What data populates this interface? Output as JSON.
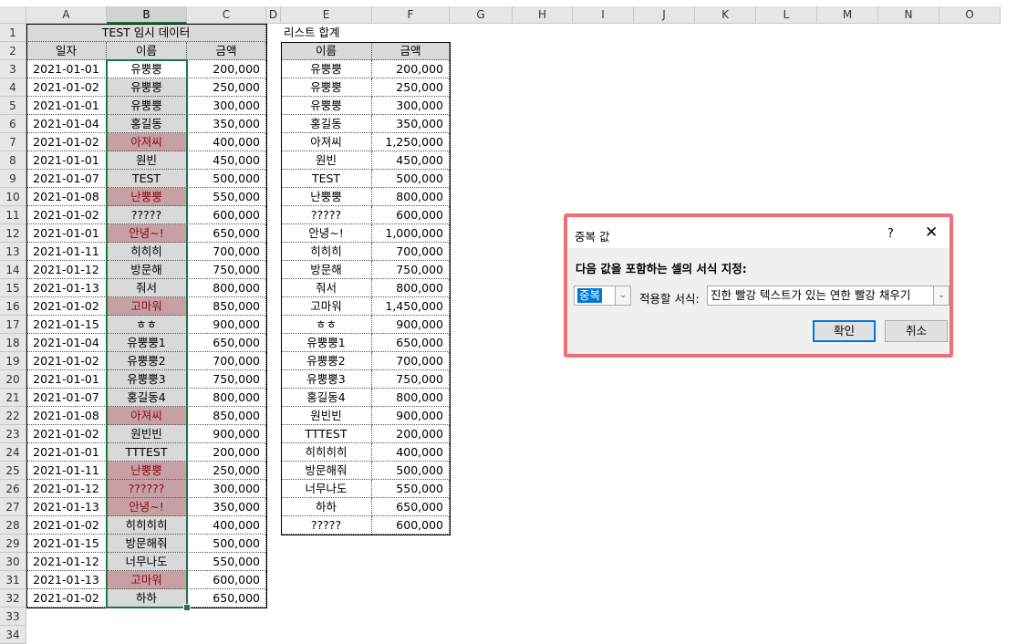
{
  "columns": [
    "A",
    "B",
    "C",
    "D",
    "E",
    "F",
    "G",
    "H",
    "I",
    "J",
    "K",
    "L",
    "M",
    "N",
    "O"
  ],
  "selected_column": "B",
  "rows": [
    1,
    2,
    3,
    4,
    5,
    6,
    7,
    8,
    9,
    10,
    11,
    12,
    13,
    14,
    15,
    16,
    17,
    18,
    19,
    20,
    21,
    22,
    23,
    24,
    25,
    26,
    27,
    28,
    29,
    30,
    31,
    32,
    33,
    34
  ],
  "left_table": {
    "title": "TEST 임시 데이터",
    "headers": [
      "일자",
      "이름",
      "금액"
    ],
    "rows": [
      {
        "date": "2021-01-01",
        "name": "유뿡뿡",
        "amount": "200,000",
        "dup": false
      },
      {
        "date": "2021-01-02",
        "name": "유뿡뿡",
        "amount": "250,000",
        "dup": false
      },
      {
        "date": "2021-01-01",
        "name": "유뿡뿡",
        "amount": "300,000",
        "dup": false
      },
      {
        "date": "2021-01-04",
        "name": "홍길동",
        "amount": "350,000",
        "dup": false
      },
      {
        "date": "2021-01-02",
        "name": "아져씨",
        "amount": "400,000",
        "dup": true
      },
      {
        "date": "2021-01-01",
        "name": "원빈",
        "amount": "450,000",
        "dup": false
      },
      {
        "date": "2021-01-07",
        "name": "TEST",
        "amount": "500,000",
        "dup": false
      },
      {
        "date": "2021-01-08",
        "name": "난뿡뿡",
        "amount": "550,000",
        "dup": true
      },
      {
        "date": "2021-01-02",
        "name": "?????",
        "amount": "600,000",
        "dup": false
      },
      {
        "date": "2021-01-01",
        "name": "안녕~!",
        "amount": "650,000",
        "dup": true
      },
      {
        "date": "2021-01-11",
        "name": "히히히",
        "amount": "700,000",
        "dup": false
      },
      {
        "date": "2021-01-12",
        "name": "방문해",
        "amount": "750,000",
        "dup": false
      },
      {
        "date": "2021-01-13",
        "name": "줘서",
        "amount": "800,000",
        "dup": false
      },
      {
        "date": "2021-01-02",
        "name": "고마워",
        "amount": "850,000",
        "dup": true
      },
      {
        "date": "2021-01-15",
        "name": "ㅎㅎ",
        "amount": "900,000",
        "dup": false
      },
      {
        "date": "2021-01-04",
        "name": "유뿡뿡1",
        "amount": "650,000",
        "dup": false
      },
      {
        "date": "2021-01-02",
        "name": "유뿡뿡2",
        "amount": "700,000",
        "dup": false
      },
      {
        "date": "2021-01-01",
        "name": "유뿡뿡3",
        "amount": "750,000",
        "dup": false
      },
      {
        "date": "2021-01-07",
        "name": "홍길동4",
        "amount": "800,000",
        "dup": false
      },
      {
        "date": "2021-01-08",
        "name": "아져씨",
        "amount": "850,000",
        "dup": true
      },
      {
        "date": "2021-01-02",
        "name": "원빈빈",
        "amount": "900,000",
        "dup": false
      },
      {
        "date": "2021-01-01",
        "name": "TTTEST",
        "amount": "200,000",
        "dup": false
      },
      {
        "date": "2021-01-11",
        "name": "난뿡뿡",
        "amount": "250,000",
        "dup": true
      },
      {
        "date": "2021-01-12",
        "name": "??????",
        "amount": "300,000",
        "dup": true
      },
      {
        "date": "2021-01-13",
        "name": "안녕~!",
        "amount": "350,000",
        "dup": true
      },
      {
        "date": "2021-01-02",
        "name": "히히히히",
        "amount": "400,000",
        "dup": false
      },
      {
        "date": "2021-01-15",
        "name": "방문해줘",
        "amount": "500,000",
        "dup": false
      },
      {
        "date": "2021-01-12",
        "name": "너무나도",
        "amount": "550,000",
        "dup": false
      },
      {
        "date": "2021-01-13",
        "name": "고마워",
        "amount": "600,000",
        "dup": true
      },
      {
        "date": "2021-01-02",
        "name": "하하",
        "amount": "650,000",
        "dup": false
      }
    ]
  },
  "right_table": {
    "title": "리스트 합계",
    "headers": [
      "이름",
      "금액"
    ],
    "rows": [
      {
        "name": "유뿡뿡",
        "amount": "200,000"
      },
      {
        "name": "유뿡뿡",
        "amount": "250,000"
      },
      {
        "name": "유뿡뿡",
        "amount": "300,000"
      },
      {
        "name": "홍길동",
        "amount": "350,000"
      },
      {
        "name": "아져씨",
        "amount": "1,250,000"
      },
      {
        "name": "원빈",
        "amount": "450,000"
      },
      {
        "name": "TEST",
        "amount": "500,000"
      },
      {
        "name": "난뿡뿡",
        "amount": "800,000"
      },
      {
        "name": "?????",
        "amount": "600,000"
      },
      {
        "name": "안녕~!",
        "amount": "1,000,000"
      },
      {
        "name": "히히히",
        "amount": "700,000"
      },
      {
        "name": "방문해",
        "amount": "750,000"
      },
      {
        "name": "줘서",
        "amount": "800,000"
      },
      {
        "name": "고마워",
        "amount": "1,450,000"
      },
      {
        "name": "ㅎㅎ",
        "amount": "900,000"
      },
      {
        "name": "유뿡뿡1",
        "amount": "650,000"
      },
      {
        "name": "유뿡뿡2",
        "amount": "700,000"
      },
      {
        "name": "유뿡뿡3",
        "amount": "750,000"
      },
      {
        "name": "홍길동4",
        "amount": "800,000"
      },
      {
        "name": "원빈빈",
        "amount": "900,000"
      },
      {
        "name": "TTTEST",
        "amount": "200,000"
      },
      {
        "name": "히히히히",
        "amount": "400,000"
      },
      {
        "name": "방문해줘",
        "amount": "500,000"
      },
      {
        "name": "너무나도",
        "amount": "550,000"
      },
      {
        "name": "하하",
        "amount": "650,000"
      },
      {
        "name": "?????",
        "amount": "600,000"
      }
    ]
  },
  "dialog": {
    "title": "중복 값",
    "help": "?",
    "close": "✕",
    "prompt": "다음 값을 포함하는 셀의 서식 지정:",
    "type_value": "중복",
    "format_label": "적용할 서식:",
    "format_value": "진한 빨강 텍스트가 있는 연한 빨강 채우기",
    "ok_label": "확인",
    "cancel_label": "취소"
  },
  "colors": {
    "duplicate_fill": "#c7a0a6",
    "duplicate_text": "#8b0a14",
    "selection": "#217346",
    "dialog_border": "#ef6f78"
  }
}
